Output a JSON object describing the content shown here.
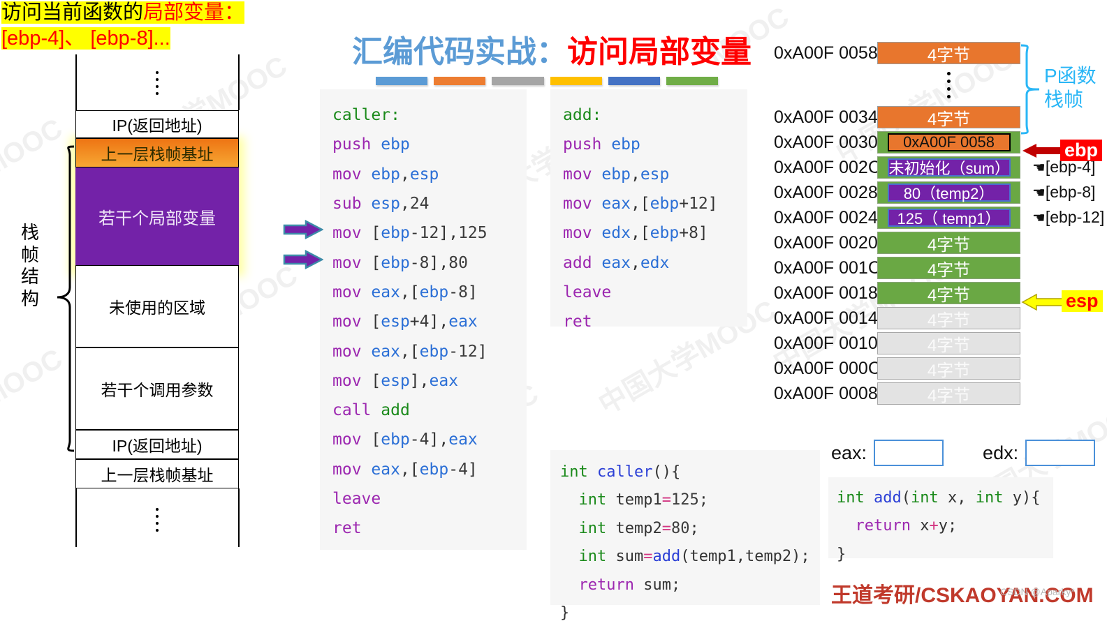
{
  "note": {
    "line1_a": "访问当前函数的",
    "line1_b": "局部变量：",
    "line2": "[ebp-4]、 [ebp-8]..."
  },
  "title": {
    "prefix": "汇编代码实战：",
    "emphasis": "访问局部变量",
    "bar_colors": [
      "#5b9bd5",
      "#ed7d31",
      "#a5a5a5",
      "#ffc000",
      "#4472c4",
      "#70ad47"
    ]
  },
  "stack_diagram": {
    "brace_label": "栈帧结构",
    "rows": [
      {
        "label": "",
        "style": "dots"
      },
      {
        "label": "IP(返回地址)",
        "style": "plain"
      },
      {
        "label": "上一层栈帧基址",
        "style": "orange"
      },
      {
        "label": "若干个局部变量",
        "style": "purple"
      },
      {
        "label": "未使用的区域",
        "style": "plain"
      },
      {
        "label": "若干个调用参数",
        "style": "plain"
      },
      {
        "label": "IP(返回地址)",
        "style": "plain"
      },
      {
        "label": "上一层栈帧基址",
        "style": "plain"
      },
      {
        "label": "",
        "style": "dots"
      }
    ]
  },
  "asm_caller": {
    "title": "caller:",
    "lines": [
      {
        "mn": "caller:",
        "ops": "",
        "kind": "label"
      },
      {
        "mn": "push",
        "ops": "ebp"
      },
      {
        "mn": "mov",
        "ops": "ebp,esp"
      },
      {
        "mn": "sub",
        "ops": "esp,24"
      },
      {
        "mn": "mov",
        "ops": "[ebp-12],125",
        "arrow": true
      },
      {
        "mn": "mov",
        "ops": "[ebp-8],80",
        "arrow": true
      },
      {
        "mn": "mov",
        "ops": "eax,[ebp-8]"
      },
      {
        "mn": "mov",
        "ops": "[esp+4],eax"
      },
      {
        "mn": "mov",
        "ops": "eax,[ebp-12]"
      },
      {
        "mn": "mov",
        "ops": "[esp],eax"
      },
      {
        "mn": "call",
        "ops": "add"
      },
      {
        "mn": "mov",
        "ops": "[ebp-4],eax"
      },
      {
        "mn": "mov",
        "ops": "eax,[ebp-4]"
      },
      {
        "mn": "leave",
        "ops": ""
      },
      {
        "mn": "ret",
        "ops": ""
      }
    ]
  },
  "asm_add": {
    "title": "add:",
    "lines": [
      {
        "mn": "add:",
        "ops": "",
        "kind": "label"
      },
      {
        "mn": "push",
        "ops": "ebp"
      },
      {
        "mn": "mov",
        "ops": "ebp,esp"
      },
      {
        "mn": "mov",
        "ops": "eax,[ebp+12]"
      },
      {
        "mn": "mov",
        "ops": "edx,[ebp+8]"
      },
      {
        "mn": "add",
        "ops": "eax,edx"
      },
      {
        "mn": "leave",
        "ops": ""
      },
      {
        "mn": "ret",
        "ops": ""
      }
    ]
  },
  "src_caller": {
    "lines": [
      "int caller(){",
      "  int temp1=125;",
      "  int temp2=80;",
      "  int sum=add(temp1,temp2);",
      "  return sum;",
      "}"
    ]
  },
  "src_add": {
    "lines": [
      "int add(int x, int y){",
      "  return x+y;",
      "}"
    ]
  },
  "memory": {
    "p_frame_label": "P函数\n栈帧",
    "rows": [
      {
        "addr": "0xA00F 0058",
        "value": "4字节",
        "style": "orange"
      },
      {
        "addr": "",
        "value": "",
        "style": "gap"
      },
      {
        "addr": "0xA00F 0034",
        "value": "4字节",
        "style": "orange"
      },
      {
        "addr": "0xA00F 0030",
        "value": "0xA00F 0058",
        "style": "green",
        "inner": "orange",
        "pointer": "ebp"
      },
      {
        "addr": "0xA00F 002C",
        "value": "未初始化（sum）",
        "style": "green",
        "inner": "purple",
        "note": "[ebp-4]"
      },
      {
        "addr": "0xA00F 0028",
        "value": "80（temp2）",
        "style": "green",
        "inner": "purple",
        "note": "[ebp-8]"
      },
      {
        "addr": "0xA00F 0024",
        "value": "125（ temp1）",
        "style": "green",
        "inner": "purple",
        "note": "[ebp-12]"
      },
      {
        "addr": "0xA00F 0020",
        "value": "4字节",
        "style": "green"
      },
      {
        "addr": "0xA00F 001C",
        "value": "4字节",
        "style": "green"
      },
      {
        "addr": "0xA00F 0018",
        "value": "4字节",
        "style": "green",
        "pointer": "esp"
      },
      {
        "addr": "0xA00F 0014",
        "value": "4字节",
        "style": "gray"
      },
      {
        "addr": "0xA00F 0010",
        "value": "4字节",
        "style": "gray"
      },
      {
        "addr": "0xA00F 000C",
        "value": "4字节",
        "style": "gray"
      },
      {
        "addr": "0xA00F 0008",
        "value": "4字节",
        "style": "gray"
      }
    ],
    "ebp_tag": "ebp",
    "esp_tag": "esp"
  },
  "registers": {
    "eax_label": "eax:",
    "eax_value": "",
    "edx_label": "edx:",
    "edx_value": ""
  },
  "brand": "王道考研/CSKAOYAN.COM",
  "csdn": "CSDN @Aparky*",
  "watermarks": [
    "MOOC",
    "中国大学MOOC",
    "中国大学"
  ]
}
